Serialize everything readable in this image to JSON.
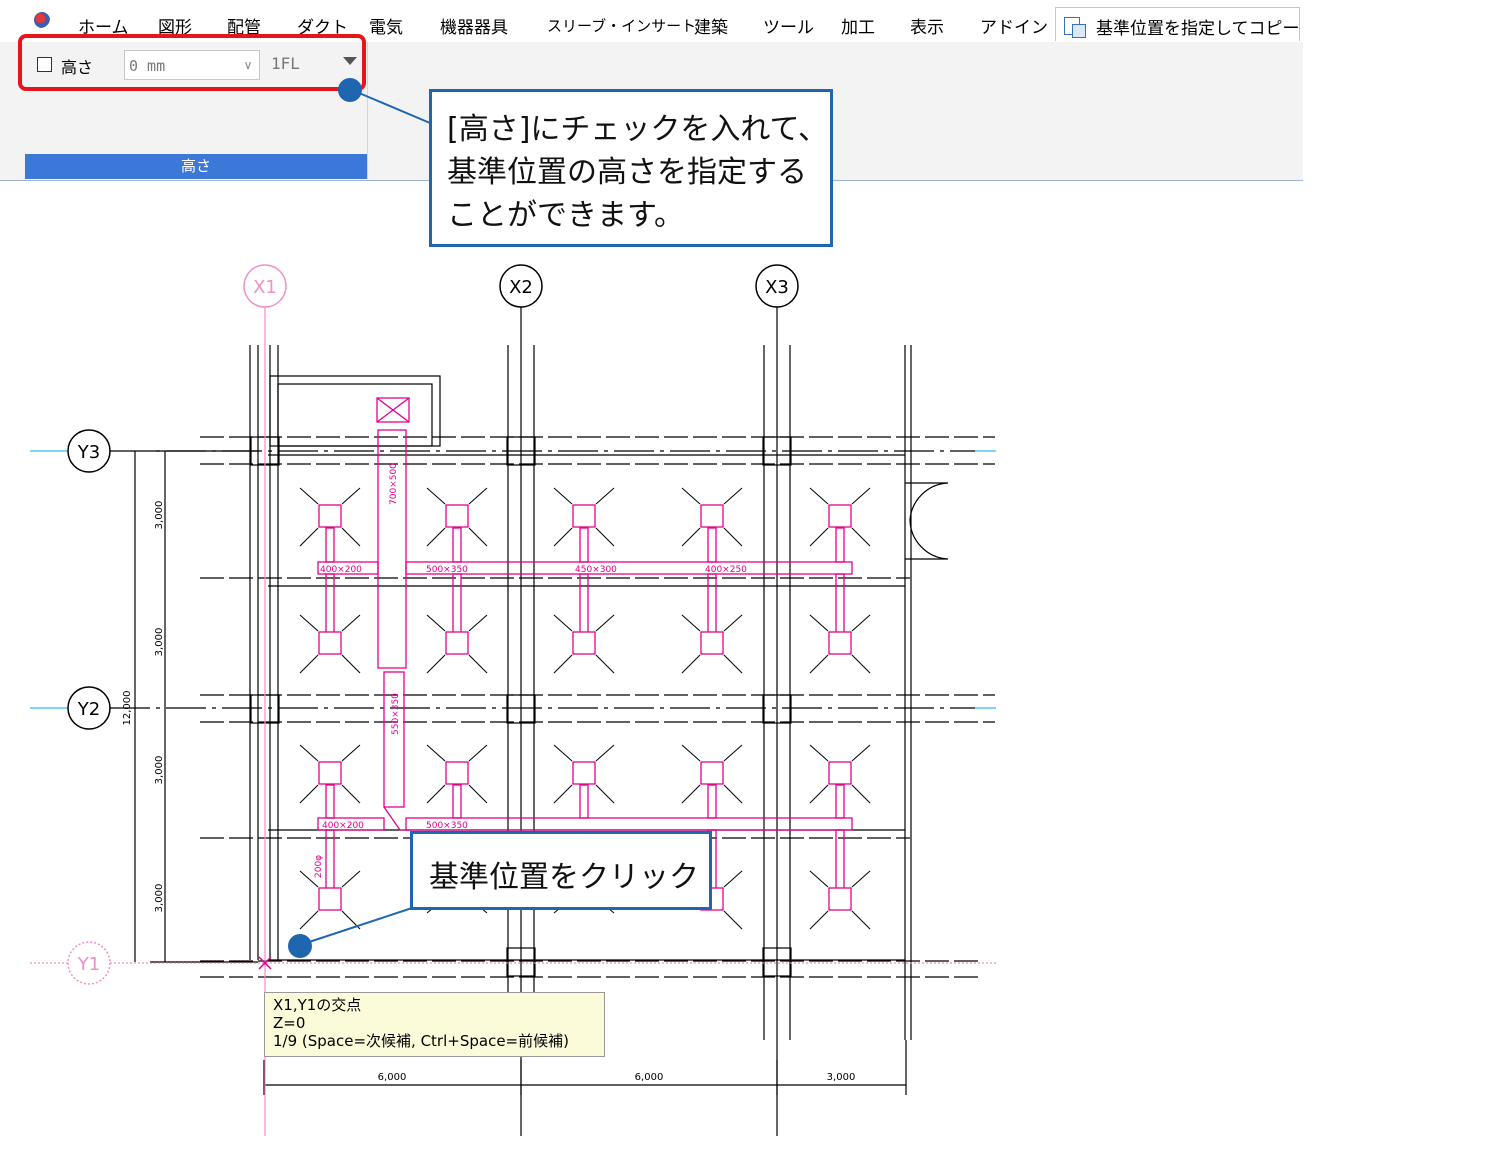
{
  "menu": {
    "items": [
      "ホーム",
      "図形",
      "配管",
      "ダクト",
      "電気",
      "機器器具",
      "スリーブ・インサート",
      "建築",
      "ツール",
      "加工",
      "表示",
      "アドイン"
    ],
    "active_tab": "基準位置を指定してコピー"
  },
  "ribbon": {
    "height_checkbox_label": "高さ",
    "height_value": "0 mm",
    "level_value": "1FL",
    "group_label": "高さ"
  },
  "callouts": {
    "top": [
      "[高さ]にチェックを入れて、",
      "基準位置の高さを指定する",
      "ことができます。"
    ],
    "bottom": "基準位置をクリック"
  },
  "grid": {
    "x": [
      "X1",
      "X2",
      "X3"
    ],
    "y": [
      "Y3",
      "Y2",
      "Y1"
    ],
    "x_dims": [
      "6,000",
      "6,000",
      "3,000"
    ],
    "y_dims": [
      "3,000",
      "3,000",
      "3,000",
      "3,000"
    ],
    "y_total": "12,000"
  },
  "duct_labels": [
    "700×500",
    "550×350",
    "400×200",
    "500×350",
    "450×300",
    "400×250",
    "400×200",
    "500×350",
    "200φ"
  ],
  "tooltip": {
    "line1": "X1,Y1の交点",
    "line2": "Z=0",
    "line3": "1/9 (Space=次候補, Ctrl+Space=前候補)"
  },
  "colors": {
    "highlight": "#e8141b",
    "callout": "#1f66b0",
    "duct": "#e4008c",
    "grid_active": "#f08fc8",
    "grid_line": "#00aeef",
    "ribbon_group": "#3c78d8"
  }
}
